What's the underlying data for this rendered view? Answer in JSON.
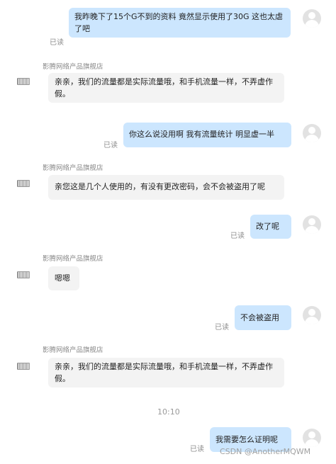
{
  "messages": {
    "m1": {
      "text": "我昨晚下了15个G不到的资料 竟然显示使用了30G 这也太虐了吧",
      "status": "已读"
    },
    "m2": {
      "sender": "影腾网络产品旗舰店",
      "text": "亲亲，我们的流量都是实际流量哦，和手机流量一样，不弄虚作假。"
    },
    "m3": {
      "text": "你这么说没用啊 我有流量统计 明显虚一半",
      "status": "已读"
    },
    "m4": {
      "sender": "影腾网络产品旗舰店",
      "text": "亲您这是几个人使用的，有没有更改密码，会不会被盗用了呢"
    },
    "m5": {
      "text": "改了呢",
      "status": "已读"
    },
    "m6": {
      "sender": "影腾网络产品旗舰店",
      "text": "嗯嗯"
    },
    "m7": {
      "text": "不会被盗用",
      "status": "已读"
    },
    "m8": {
      "sender": "影腾网络产品旗舰店",
      "text": "亲亲，我们的流量都是实际流量哦，和手机流量一样，不弄虚作假。"
    },
    "m9": {
      "text": "我需要怎么证明呢",
      "status": "已读"
    }
  },
  "time_separator": "10:10",
  "watermark": "CSDN @AnotherMQWM",
  "colors": {
    "user_bubble": "#cce6fe",
    "shop_bubble": "#f3f3f3",
    "avatar_bg": "#e2e2e2"
  }
}
